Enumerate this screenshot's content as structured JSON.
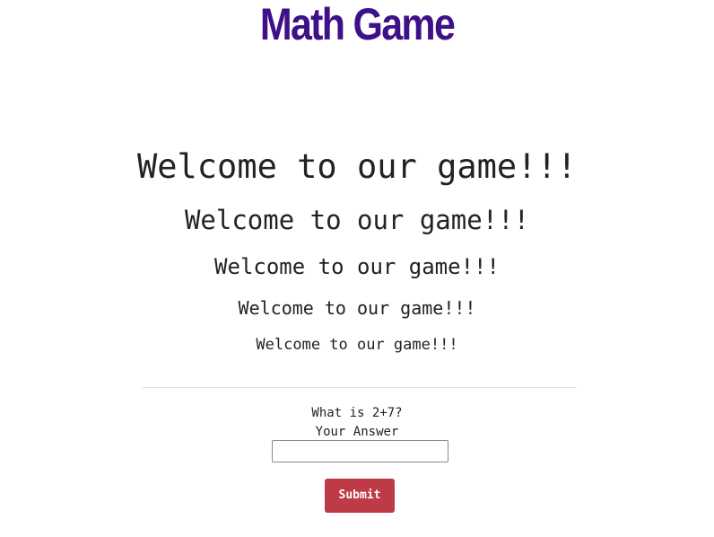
{
  "header": {
    "title": "Math Game",
    "title_color": "#3f1189"
  },
  "welcome": {
    "lines": [
      "Welcome to our game!!!",
      "Welcome to our game!!!",
      "Welcome to our game!!!",
      "Welcome to our game!!!",
      "Welcome to our game!!!"
    ]
  },
  "quiz": {
    "question": "What is 2+7?",
    "answer_label": "Your Answer",
    "answer_value": "",
    "answer_placeholder": "",
    "submit_label": "Submit",
    "submit_color": "#be3a46"
  }
}
